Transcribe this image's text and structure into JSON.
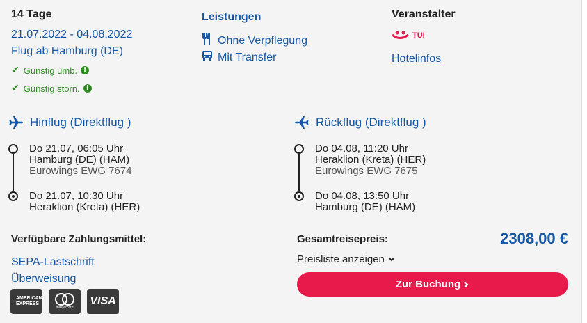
{
  "trip": {
    "duration": "14 Tage",
    "dates": "21.07.2022 - 04.08.2022",
    "departure": "Flug ab Hamburg (DE)",
    "cheap_rebook": "Günstig umb.",
    "cheap_cancel": "Günstig storn."
  },
  "services": {
    "title": "Leistungen",
    "items": [
      {
        "label": "Ohne Verpflegung",
        "icon": "cutlery-icon"
      },
      {
        "label": "Mit Transfer",
        "icon": "bus-icon"
      }
    ]
  },
  "operator": {
    "title": "Veranstalter",
    "brand": "TUI",
    "hotel_info": "Hotelinfos",
    "brand_color": "#e8194b"
  },
  "outbound": {
    "title": "Hinflug (Direktflug )",
    "dep_time": "Do 21.07, 06:05 Uhr",
    "dep_airport": "Hamburg (DE) (HAM)",
    "flight": "Eurowings EWG 7674",
    "arr_time": "Do 21.07, 10:30 Uhr",
    "arr_airport": "Heraklion (Kreta) (HER)"
  },
  "inbound": {
    "title": "Rückflug (Direktflug )",
    "dep_time": "Do 04.08, 11:20 Uhr",
    "dep_airport": "Heraklion (Kreta) (HER)",
    "flight": "Eurowings EWG 7675",
    "arr_time": "Do 04.08, 13:50 Uhr",
    "arr_airport": "Hamburg (DE) (HAM)"
  },
  "payment": {
    "title": "Verfügbare Zahlungsmittel:",
    "methods": [
      "SEPA-Lastschrift",
      "Überweisung"
    ],
    "cards": [
      "AMERICAN EXPRESS",
      "mastercard",
      "VISA"
    ]
  },
  "price": {
    "label": "Gesamtreisepreis:",
    "value": "2308,00 €",
    "price_list": "Preisliste anzeigen",
    "book": "Zur Buchung"
  },
  "colors": {
    "accent": "#1558a7",
    "cta": "#e8194b",
    "ok": "#2e8b21"
  }
}
